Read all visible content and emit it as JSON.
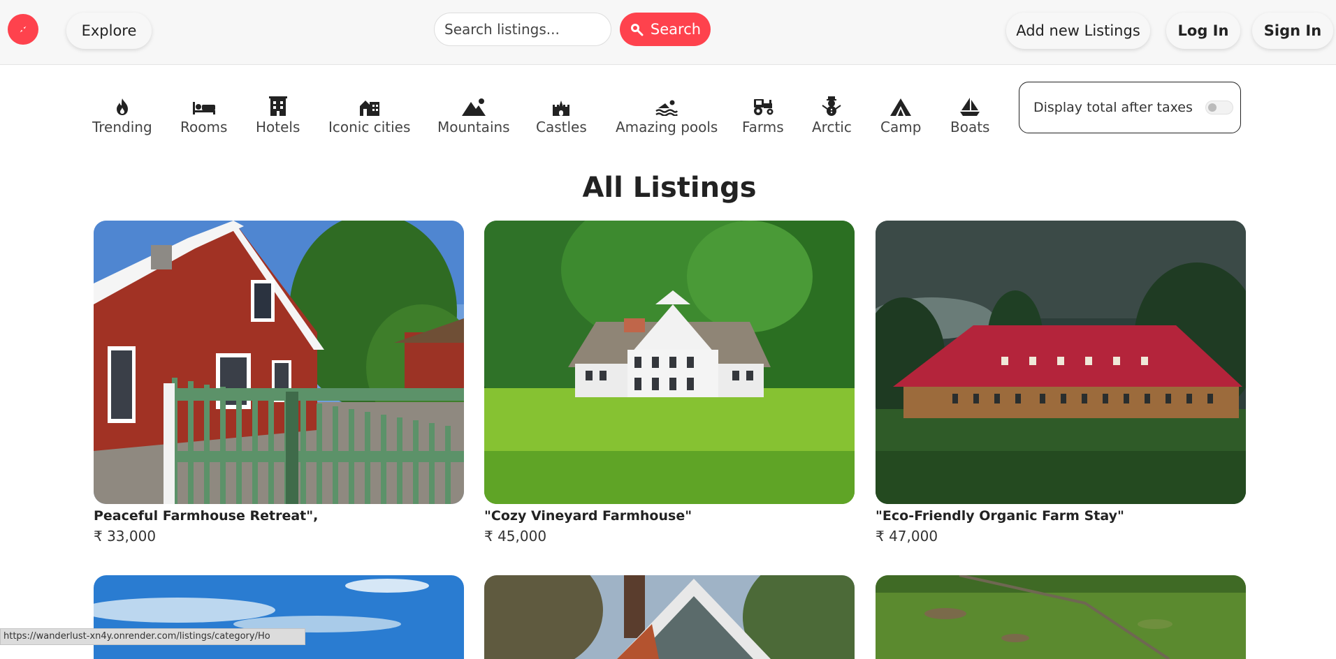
{
  "navbar": {
    "explore_label": "Explore",
    "search_placeholder": "Search listings...",
    "search_label": "Search",
    "add_listing_label": "Add new Listings",
    "login_label": "Log In",
    "signin_label": "Sign In"
  },
  "filters": [
    {
      "label": "Trending",
      "icon": "fire-icon"
    },
    {
      "label": "Rooms",
      "icon": "bed-icon"
    },
    {
      "label": "Hotels",
      "icon": "hotel-icon"
    },
    {
      "label": "Iconic cities",
      "icon": "city-icon"
    },
    {
      "label": "Mountains",
      "icon": "mountain-icon"
    },
    {
      "label": "Castles",
      "icon": "castle-icon"
    },
    {
      "label": "Amazing pools",
      "icon": "swimmer-icon"
    },
    {
      "label": "Farms",
      "icon": "tractor-icon"
    },
    {
      "label": "Arctic",
      "icon": "snowman-icon"
    },
    {
      "label": "Camp",
      "icon": "tent-icon"
    },
    {
      "label": "Boats",
      "icon": "sailboat-icon"
    }
  ],
  "tax_toggle": {
    "label": "Display total after taxes",
    "enabled": false
  },
  "page": {
    "heading": "All Listings"
  },
  "listings": [
    {
      "title": "Peaceful Farmhouse Retreat\",",
      "price": "₹ 33,000"
    },
    {
      "title": "\"Cozy Vineyard Farmhouse\"",
      "price": "₹ 45,000"
    },
    {
      "title": "\"Eco-Friendly Organic Farm Stay\"",
      "price": "₹ 47,000"
    }
  ],
  "status_bar": {
    "url": "https://wanderlust-xn4y.onrender.com/listings/category/Ho"
  },
  "colors": {
    "brand": "#fe424d",
    "navbar_bg": "#f7f7f7"
  }
}
